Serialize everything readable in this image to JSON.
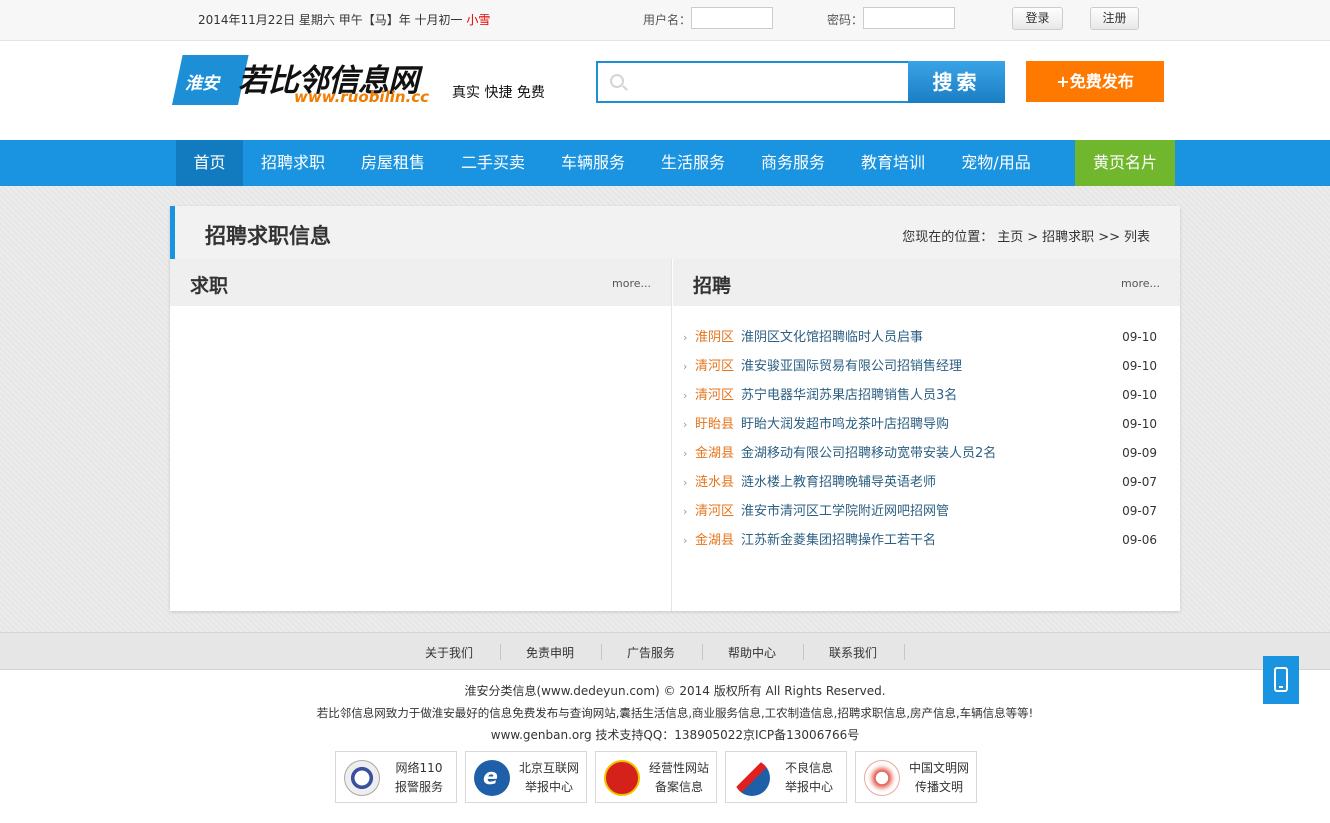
{
  "topbar": {
    "date": "2014年11月22日 星期六  甲午【马】年 十月初一 ",
    "weather": "小雪",
    "username_label": "用户名：",
    "password_label": "密码：",
    "login": "登录",
    "register": "注册"
  },
  "header": {
    "logo_badge": "淮安",
    "logo_name": "若比邻信息网",
    "logo_url": "www.ruobilin.cc",
    "slogan": "真实  快捷  免费",
    "search_button": "搜索",
    "post_button": "+免费发布"
  },
  "nav": [
    "首页",
    "招聘求职",
    "房屋租售",
    "二手买卖",
    "车辆服务",
    "生活服务",
    "商务服务",
    "教育培训",
    "宠物/用品",
    "黄页名片"
  ],
  "page": {
    "title": "招聘求职信息",
    "breadcrumb_label": "您现在的位置：",
    "breadcrumb": [
      "主页",
      ">",
      "招聘求职",
      ">>",
      "列表"
    ]
  },
  "left_col": {
    "title": "求职",
    "more": "more..."
  },
  "right_col": {
    "title": "招聘",
    "more": "more...",
    "items": [
      {
        "area": "淮阴区",
        "title": "淮阴区文化馆招聘临时人员启事",
        "date": "09-10"
      },
      {
        "area": "清河区",
        "title": " 淮安骏亚国际贸易有限公司招销售经理",
        "date": "09-10"
      },
      {
        "area": "清河区",
        "title": "苏宁电器华润苏果店招聘销售人员3名",
        "date": "09-10"
      },
      {
        "area": "盱眙县",
        "title": "盱眙大润发超市鸣龙茶叶店招聘导购",
        "date": "09-10"
      },
      {
        "area": "金湖县",
        "title": "金湖移动有限公司招聘移动宽带安装人员2名",
        "date": "09-09"
      },
      {
        "area": "涟水县",
        "title": "涟水楼上教育招聘晚辅导英语老师",
        "date": "09-07"
      },
      {
        "area": "清河区",
        "title": "淮安市清河区工学院附近网吧招网管",
        "date": "09-07"
      },
      {
        "area": "金湖县",
        "title": "江苏新金菱集团招聘操作工若干名",
        "date": "09-06"
      }
    ]
  },
  "footer": {
    "nav": [
      "关于我们",
      "免责申明",
      "广告服务",
      "帮助中心",
      "联系我们"
    ],
    "line1": "淮安分类信息(www.dedeyun.com) © 2014 版权所有 All Rights Reserved.",
    "line2": "若比邻信息网致力于做淮安最好的信息免费发布与查询网站,囊括生活信息,商业服务信息,工农制造信息,招聘求职信息,房产信息,车辆信息等等!",
    "line3": "www.genban.org 技术支持QQ：138905022京ICP备13006766号",
    "badges": [
      {
        "line1": "网络110",
        "line2": "报警服务"
      },
      {
        "line1": "北京互联网",
        "line2": "举报中心"
      },
      {
        "line1": "经营性网站",
        "line2": "备案信息"
      },
      {
        "line1": "不良信息",
        "line2": "举报中心"
      },
      {
        "line1": "中国文明网",
        "line2": "传播文明"
      }
    ]
  },
  "colors": {
    "primary": "#1a94e0",
    "orange": "#ff7800",
    "green": "#71b72e",
    "area": "#e5751c",
    "link": "#2c5f82"
  }
}
